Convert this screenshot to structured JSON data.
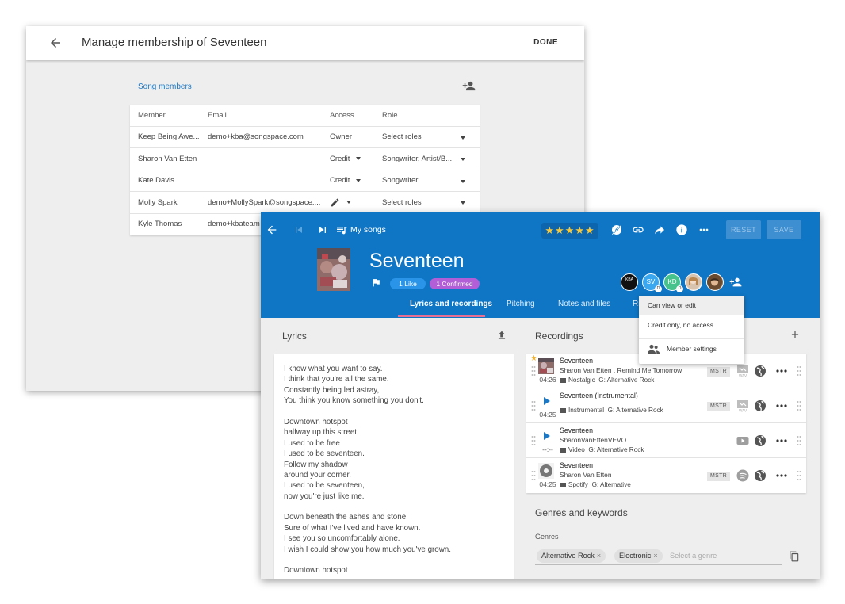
{
  "membership": {
    "title": "Manage membership of Seventeen",
    "done_label": "DONE",
    "section_title": "Song members",
    "columns": [
      "Member",
      "Email",
      "Access",
      "Role"
    ],
    "rows": [
      {
        "member": "Keep Being Awe...",
        "email": "demo+kba@songspace.com",
        "access": "Owner",
        "role": "Select roles",
        "access_dd": false
      },
      {
        "member": "Sharon Van Etten",
        "email": "",
        "access": "Credit",
        "role": "Songwriter, Artist/B...",
        "access_dd": true
      },
      {
        "member": "Kate Davis",
        "email": "",
        "access": "Credit",
        "role": "Songwriter",
        "access_dd": true
      },
      {
        "member": "Molly Spark",
        "email": "demo+MollySpark@songspace....",
        "access": "",
        "role": "Select roles",
        "access_dd": true
      },
      {
        "member": "Kyle Thomas",
        "email": "demo+kbateam",
        "access": "",
        "role": "",
        "access_dd": false
      }
    ]
  },
  "song": {
    "nav_label": "My songs",
    "stars": "★★★★★",
    "reset_label": "RESET",
    "save_label": "SAVE",
    "title": "Seventeen",
    "like_pill": "1  Like",
    "confirmed_pill": "1 Confirmed",
    "avatars": [
      {
        "initials": "KBA",
        "color": "#111111"
      },
      {
        "initials": "SV",
        "color": "#3aa7ef",
        "sub": "D"
      },
      {
        "initials": "KD",
        "color": "#46c28c",
        "sub": "D"
      },
      {
        "initials": "",
        "color": "#c9a37a"
      },
      {
        "initials": "",
        "color": "#8a6a4a"
      }
    ],
    "tabs": [
      "Lyrics and recordings",
      "Pitching",
      "Notes and files",
      "Ri"
    ],
    "menu": {
      "items": [
        "Can view or edit",
        "Credit only, no access",
        "Member settings"
      ]
    },
    "lyrics_title": "Lyrics",
    "lyrics": [
      "I know what you want to say.",
      "I think that you're all the same.",
      "Constantly being led astray,",
      "You think you know something you don't.",
      "",
      "Downtown hotspot",
      "halfway up this street",
      "I used to be free",
      "I used to be seventeen.",
      "Follow my shadow",
      "around your corner.",
      "I used to be seventeen,",
      "now you're just like me.",
      "",
      "Down beneath the ashes and stone,",
      "Sure of what I've lived and have known.",
      "I see you so uncomfortably alone.",
      "I wish I could show you how much you've grown.",
      "",
      "Downtown hotspot"
    ],
    "recordings_title": "Recordings",
    "recordings": [
      {
        "title": "Seventeen",
        "artist": "Sharon Van Etten , Remind Me Tomorrow",
        "duration": "04:26",
        "tag": "Nostalgic",
        "genre": "G: Alternative Rock",
        "mstr": "MSTR",
        "source": "wav",
        "starred": true,
        "thumb": "art"
      },
      {
        "title": "Seventeen (Instrumental)",
        "artist": "",
        "duration": "04:25",
        "tag": "Instrumental",
        "genre": "G: Alternative Rock",
        "mstr": "MSTR",
        "source": "wav",
        "starred": false,
        "thumb": "play"
      },
      {
        "title": "Seventeen",
        "artist": "SharonVanEttenVEVO",
        "duration": "--:--",
        "tag": "Video",
        "genre": "G: Alternative Rock",
        "mstr": "",
        "source": "video",
        "starred": false,
        "thumb": "play"
      },
      {
        "title": "Seventeen",
        "artist": "Sharon Van Etten",
        "duration": "04:25",
        "tag": "Spotify",
        "genre": "G: Alternative",
        "mstr": "MSTR",
        "source": "spotify",
        "starred": false,
        "thumb": "disc"
      }
    ],
    "genres_title": "Genres and keywords",
    "genres_label": "Genres",
    "genre_chips": [
      "Alternative Rock",
      "Electronic"
    ],
    "genre_placeholder": "Select a genre"
  }
}
